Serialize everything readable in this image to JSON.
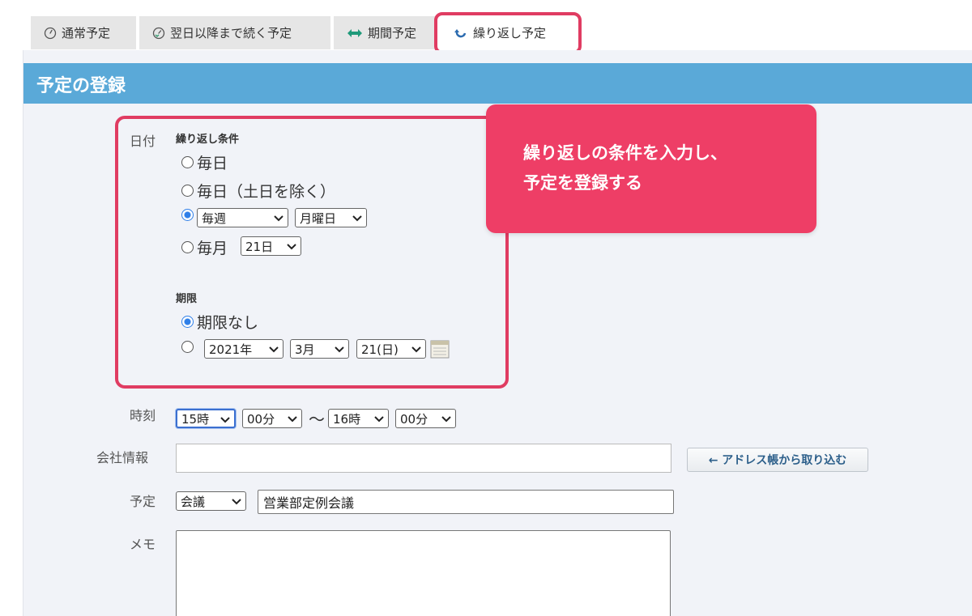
{
  "tabs": [
    {
      "label": "通常予定",
      "icon": "clock-icon"
    },
    {
      "label": "翌日以降まで続く予定",
      "icon": "clock-continue-icon"
    },
    {
      "label": "期間予定",
      "icon": "double-arrow-icon"
    },
    {
      "label": "繰り返し予定",
      "icon": "repeat-icon",
      "active": true
    }
  ],
  "panel": {
    "title": "予定の登録"
  },
  "date_section": {
    "label": "日付",
    "repeat_condition_title": "繰り返し条件",
    "options": {
      "daily": "毎日",
      "weekdays": "毎日（土日を除く）",
      "weekly_freq": "毎週",
      "weekly_day": "月曜日",
      "monthly": "毎月",
      "monthly_day": "21日"
    },
    "selected_condition": "weekly",
    "limit_title": "期限",
    "limit_none": "期限なし",
    "selected_limit": "none",
    "limit_year": "2021年",
    "limit_month": "3月",
    "limit_day": "21(日)"
  },
  "time": {
    "label": "時刻",
    "start_hour": "15時",
    "start_min": "00分",
    "separator": "〜",
    "end_hour": "16時",
    "end_min": "00分"
  },
  "company": {
    "label": "会社情報",
    "value": "",
    "import_button": "← アドレス帳から取り込む"
  },
  "schedule": {
    "label": "予定",
    "type": "会議",
    "title": "営業部定例会議"
  },
  "memo": {
    "label": "メモ",
    "value": ""
  },
  "callout": {
    "text": "繰り返しの条件を入力し、\n予定を登録する"
  },
  "colors": {
    "accent": "#e03c62",
    "header": "#5aa9d8",
    "callout": "#ee3e66",
    "radio_on": "#2f7fe8"
  }
}
